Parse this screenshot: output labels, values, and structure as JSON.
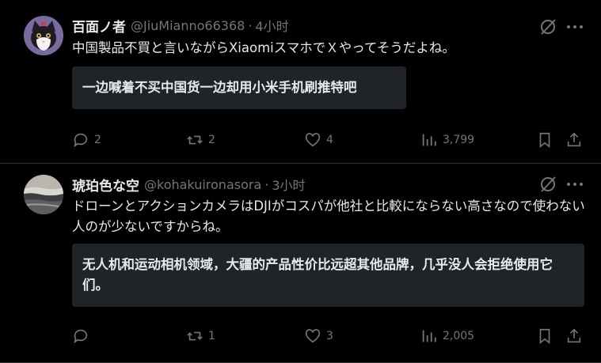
{
  "tweets": [
    {
      "display_name": "百面ノ者",
      "handle": "@JiuMianno66368",
      "separator": "·",
      "time": "4小时",
      "text": "中国製品不買と言いながらXiaomiスマホでＸやってそうだよね。",
      "translation": "一边喊着不买中国货一边却用小米手机刷推特吧",
      "stats": {
        "replies": "2",
        "reposts": "2",
        "likes": "4",
        "views": "3,799"
      }
    },
    {
      "display_name": "琥珀色な空",
      "handle": "@kohakuironasora",
      "separator": "·",
      "time": "3小时",
      "text": "ドローンとアクションカメラはDJIがコスパが他社と比較にならない高さなので使わない人のが少ないですからね。",
      "translation": "无人机和运动相机领域，大疆的产品性价比远超其他品牌，几乎没人会拒绝使用它们。",
      "stats": {
        "replies": "",
        "reposts": "1",
        "likes": "3",
        "views": "2,005"
      }
    }
  ],
  "icons": {
    "reply": "reply-icon",
    "repost": "repost-icon",
    "like": "heart-icon",
    "views": "views-icon",
    "bookmark": "bookmark-icon",
    "share": "share-icon",
    "grok": "grok-icon",
    "more": "more-icon"
  },
  "colors": {
    "background": "#000000",
    "text": "#e7e9ea",
    "muted": "#71767b",
    "translation_bg": "#202327",
    "divider": "#2f3336"
  }
}
